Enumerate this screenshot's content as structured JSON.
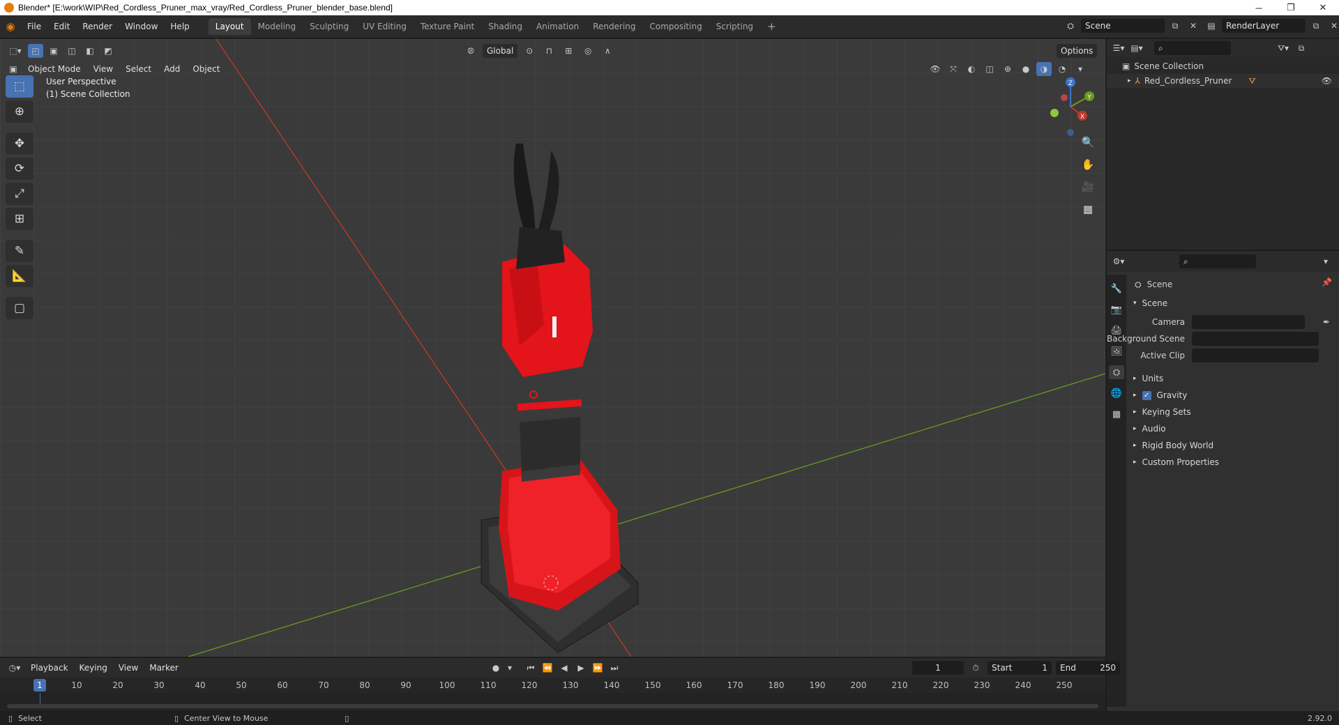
{
  "window": {
    "title": "Blender* [E:\\work\\WIP\\Red_Cordless_Pruner_max_vray/Red_Cordless_Pruner_blender_base.blend]",
    "controls": [
      "─",
      "❐",
      "✕"
    ]
  },
  "menu": [
    "File",
    "Edit",
    "Render",
    "Window",
    "Help"
  ],
  "workspaces": [
    {
      "label": "Layout",
      "active": true
    },
    {
      "label": "Modeling"
    },
    {
      "label": "Sculpting"
    },
    {
      "label": "UV Editing"
    },
    {
      "label": "Texture Paint"
    },
    {
      "label": "Shading"
    },
    {
      "label": "Animation"
    },
    {
      "label": "Rendering"
    },
    {
      "label": "Compositing"
    },
    {
      "label": "Scripting"
    }
  ],
  "workspace_add": "+",
  "scene_field": "Scene",
  "renderlayer_field": "RenderLayer",
  "viewport": {
    "transform_orientation": "Global",
    "options_label": "Options",
    "mode": "Object Mode",
    "header_menus": [
      "View",
      "Select",
      "Add",
      "Object"
    ],
    "perspective": "User Perspective",
    "collection": "(1) Scene Collection",
    "gizmo": {
      "z": "Z",
      "y": "Y",
      "x": "X"
    }
  },
  "outliner": {
    "root": "Scene Collection",
    "items": [
      "Red_Cordless_Pruner"
    ]
  },
  "properties": {
    "context": "Scene",
    "panel": "Scene",
    "rows": [
      {
        "label": "Camera",
        "value": ""
      },
      {
        "label": "Background Scene",
        "value": ""
      },
      {
        "label": "Active Clip",
        "value": ""
      }
    ],
    "subpanels": [
      "Units",
      "Gravity",
      "Keying Sets",
      "Audio",
      "Rigid Body World",
      "Custom Properties"
    ],
    "gravity_checked": true
  },
  "timeline": {
    "menus": [
      "Playback",
      "Keying",
      "View",
      "Marker"
    ],
    "current_frame": "1",
    "start_label": "Start",
    "start": "1",
    "end_label": "End",
    "end": "250",
    "ticks": [
      "1",
      "10",
      "20",
      "30",
      "40",
      "50",
      "60",
      "70",
      "80",
      "90",
      "100",
      "110",
      "120",
      "130",
      "140",
      "150",
      "160",
      "170",
      "180",
      "190",
      "200",
      "210",
      "220",
      "230",
      "240",
      "250"
    ]
  },
  "status": {
    "select": "Select",
    "center_view": "Center View to Mouse",
    "version": "2.92.0"
  },
  "colors": {
    "accent": "#4772b3",
    "pruner_red": "#e3141a",
    "x_axis": "#c0392b",
    "y_axis": "#6a9a1e"
  }
}
